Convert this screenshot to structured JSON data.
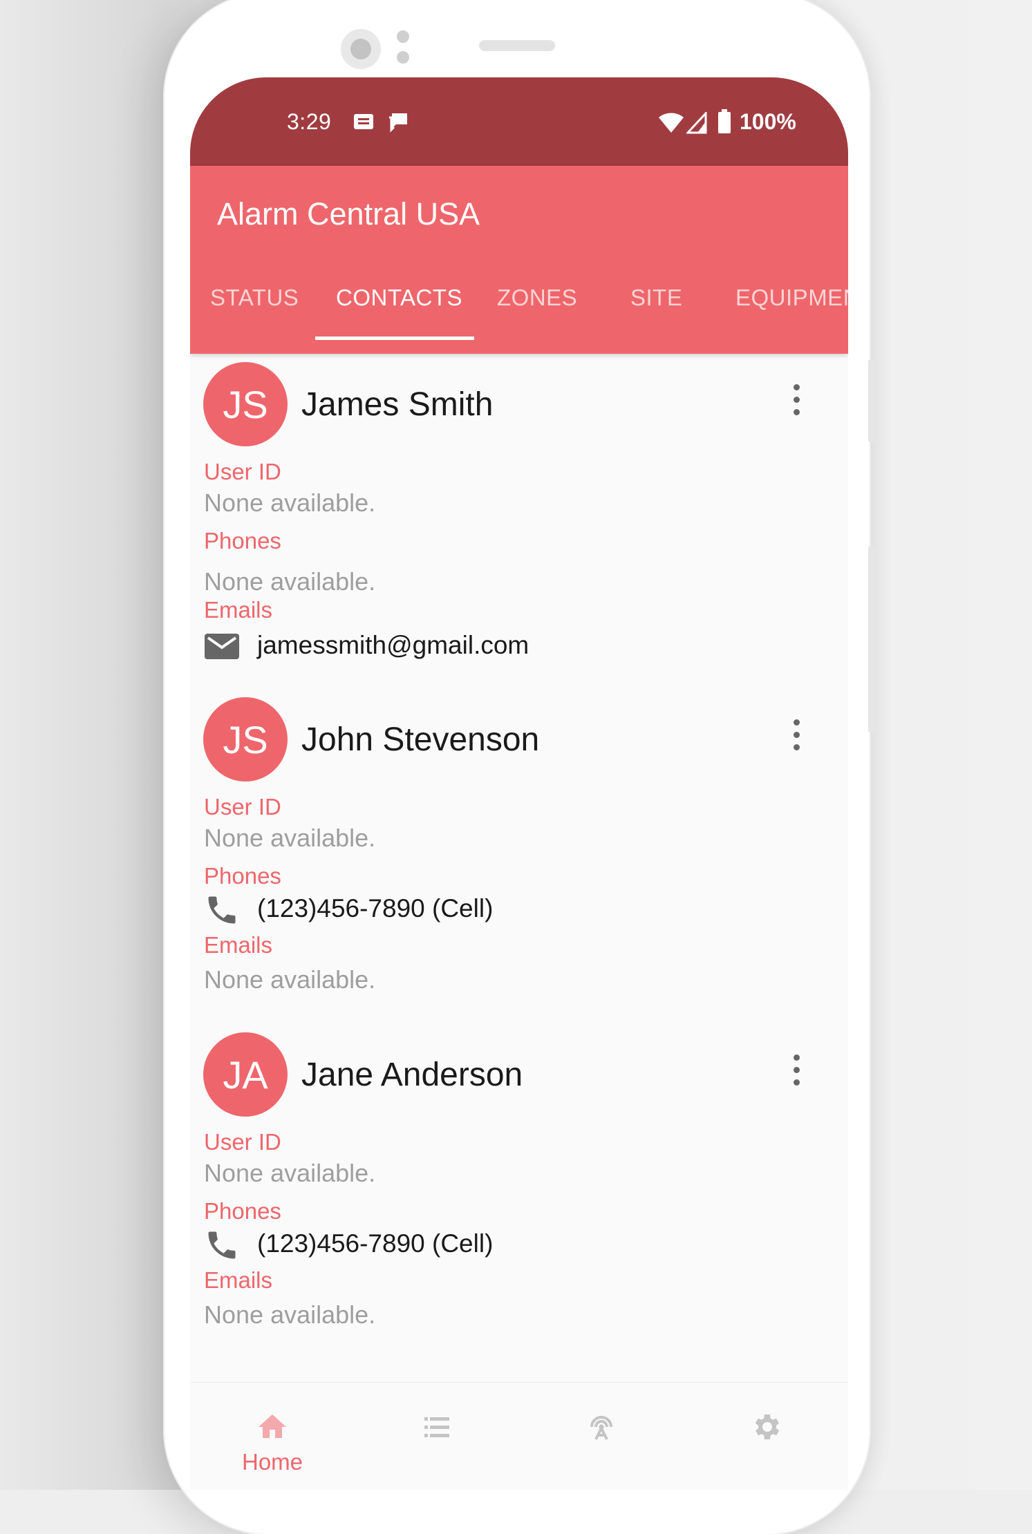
{
  "status_bar": {
    "time": "3:29",
    "battery": "100%",
    "icons": [
      "message-icon",
      "chat-icon",
      "wifi-icon",
      "signal-icon",
      "battery-icon"
    ]
  },
  "app_bar": {
    "title": "Alarm Central USA",
    "tabs": [
      {
        "label": "STATUS",
        "active": false
      },
      {
        "label": "CONTACTS",
        "active": true
      },
      {
        "label": "ZONES",
        "active": false
      },
      {
        "label": "SITE",
        "active": false
      },
      {
        "label": "EQUIPMEN",
        "active": false
      }
    ]
  },
  "labels": {
    "user_id": "User ID",
    "phones": "Phones",
    "emails": "Emails",
    "none": "None available."
  },
  "contacts": [
    {
      "initials": "JS",
      "name": "James Smith",
      "user_id": "None available.",
      "phones": "None available.",
      "email": "jamessmith@gmail.com"
    },
    {
      "initials": "JS",
      "name": "John Stevenson",
      "user_id": "None available.",
      "phone": "(123)456-7890 (Cell)",
      "emails": "None available."
    },
    {
      "initials": "JA",
      "name": "Jane Anderson",
      "user_id": "None available.",
      "phone": "(123)456-7890 (Cell)",
      "emails": "None available."
    }
  ],
  "bottom_nav": {
    "items": [
      {
        "label": "Home",
        "icon": "home-icon",
        "active": true
      },
      {
        "icon": "list-icon",
        "active": false
      },
      {
        "icon": "antenna-icon",
        "active": false
      },
      {
        "icon": "gear-icon",
        "active": false
      }
    ]
  },
  "colors": {
    "primary": "#ee666b",
    "status_bar": "#a03c40",
    "icon_grey": "#666666",
    "inactive_nav": "#c4c4c4"
  }
}
